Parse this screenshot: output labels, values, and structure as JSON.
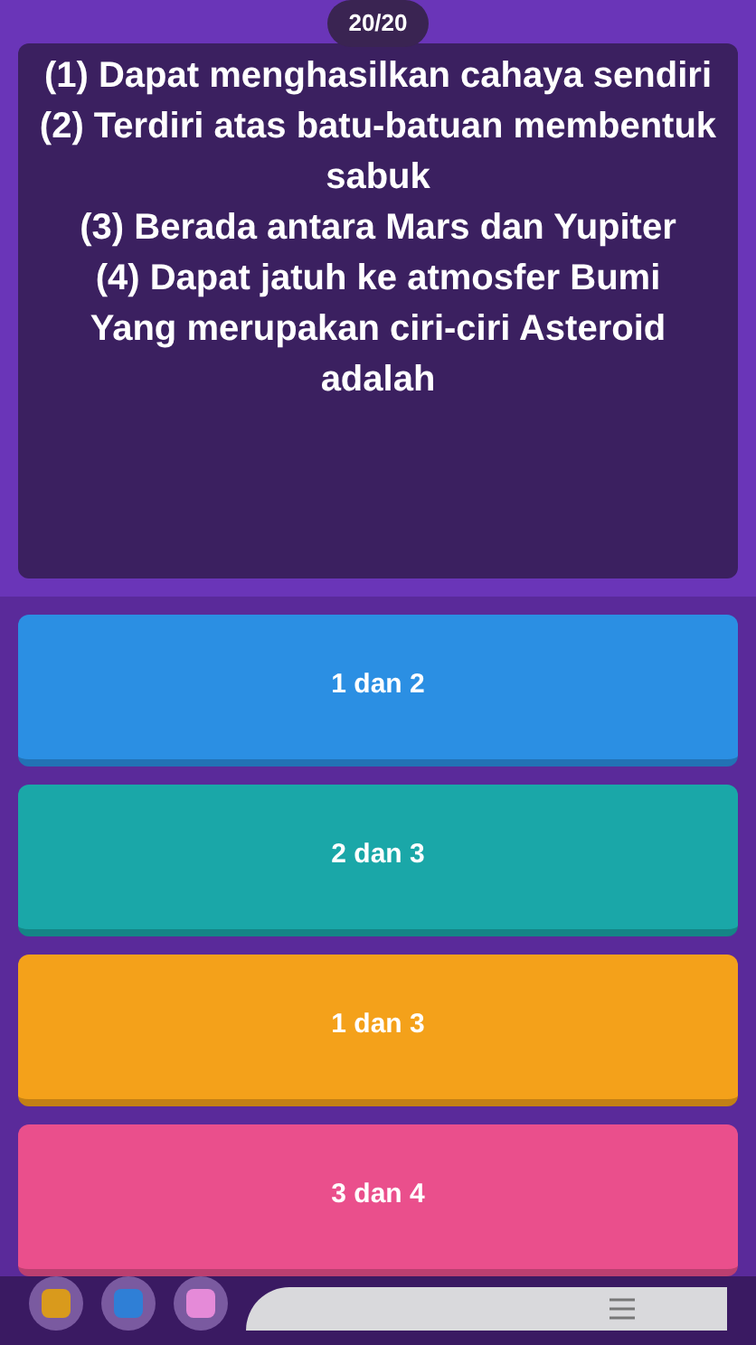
{
  "counter": "20/20",
  "question_lines": [
    "(1) Dapat menghasilkan cahaya sendiri",
    "(2) Terdiri atas batu-batuan membentuk sabuk",
    "(3) Berada antara Mars dan Yupiter",
    "(4) Dapat jatuh ke atmosfer Bumi",
    "Yang merupakan ciri-ciri Asteroid adalah"
  ],
  "options": [
    {
      "label": "1 dan 2",
      "color": "#2b8fe3"
    },
    {
      "label": "2 dan 3",
      "color": "#1aa7a8"
    },
    {
      "label": "1 dan 3",
      "color": "#f4a11a"
    },
    {
      "label": "3 dan 4",
      "color": "#ea4f8c"
    }
  ],
  "powerups": [
    {
      "color": "#d99a1c"
    },
    {
      "color": "#2f7fd6"
    },
    {
      "color": "#e58ad8"
    }
  ]
}
